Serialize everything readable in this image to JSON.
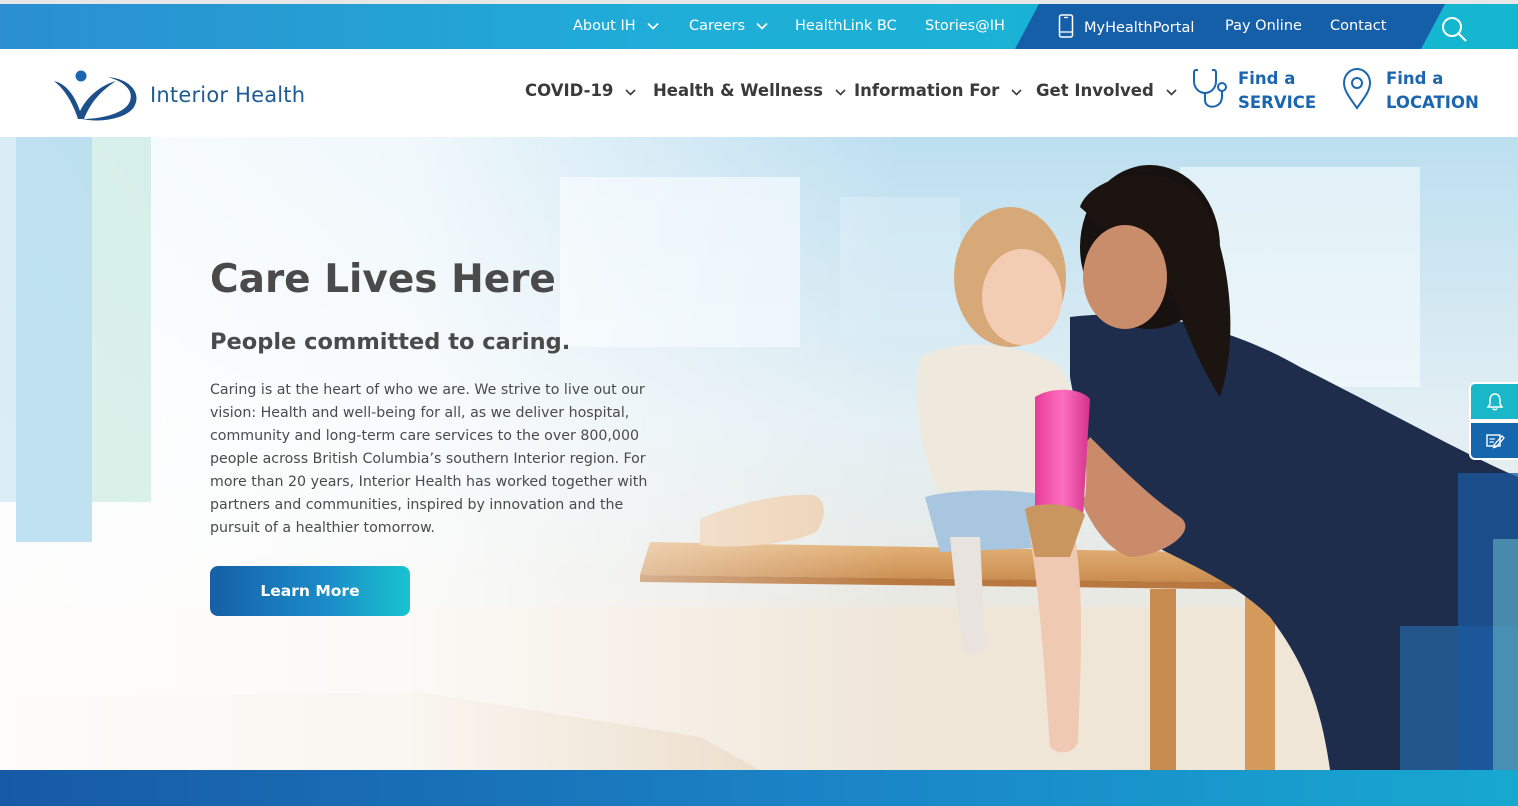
{
  "utility_nav": {
    "about": "About IH",
    "careers": "Careers",
    "healthlink": "HealthLink BC",
    "stories": "Stories@IH",
    "myhealthportal": "MyHealthPortal",
    "pay_online": "Pay Online",
    "contact": "Contact"
  },
  "brand": {
    "name": "Interior Health"
  },
  "main_nav": {
    "covid": "COVID-19",
    "health_wellness": "Health & Wellness",
    "information_for": "Information For",
    "get_involved": "Get Involved"
  },
  "finders": {
    "service_line1": "Find a",
    "service_line2": "SERVICE",
    "location_line1": "Find a",
    "location_line2": "LOCATION"
  },
  "hero": {
    "title": "Care Lives Here",
    "subtitle": "People committed to caring.",
    "body": "Caring is at the heart of who we are. We strive to live out our vision: Health and well-being for all, as we deliver hospital, community and long-term care services to the over 800,000 people across British Columbia’s southern Interior region. For more than 20 years, Interior Health has worked together with partners and communities, inspired by innovation and the pursuit of a healthier tomorrow.",
    "cta": "Learn More"
  },
  "colors": {
    "brand_blue": "#1b66b0",
    "accent_teal": "#19b7c8",
    "dark_navy": "#155fa9",
    "text_gray": "#4a4a4a"
  },
  "icons": {
    "search": "search-icon",
    "phone": "phone-icon",
    "stethoscope": "stethoscope-icon",
    "location_pin": "location-pin-icon",
    "bell": "bell-icon",
    "feedback": "feedback-icon"
  }
}
